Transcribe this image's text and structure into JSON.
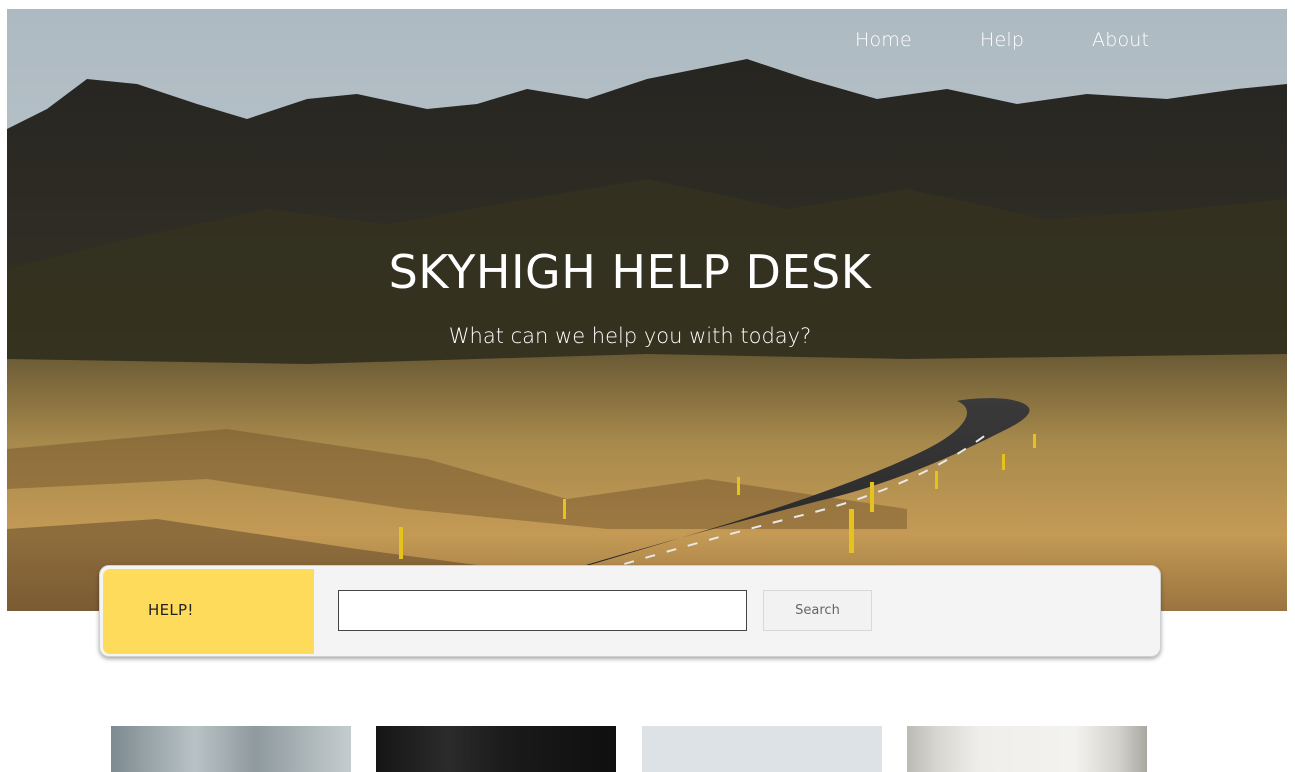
{
  "nav": {
    "items": [
      {
        "label": "Home"
      },
      {
        "label": "Help"
      },
      {
        "label": "About"
      }
    ]
  },
  "hero": {
    "title": "SKYHIGH HELP DESK",
    "subtitle": "What can we help you with today?"
  },
  "search_panel": {
    "help_label": "HELP!",
    "input_value": "",
    "input_placeholder": "",
    "button_label": "Search"
  },
  "cards": [
    {
      "image": "cloudy-sky-photo"
    },
    {
      "image": "dark-photo"
    },
    {
      "image": "pale-sky-photo"
    },
    {
      "image": "white-corridor-photo"
    }
  ],
  "colors": {
    "help_accent": "#ffdb5c",
    "panel_bg": "#f4f4f4",
    "text_light": "#ffffff"
  }
}
